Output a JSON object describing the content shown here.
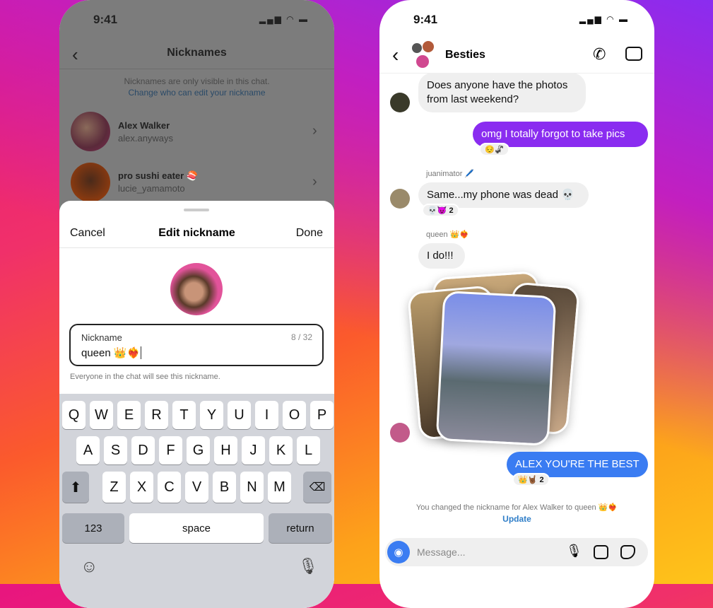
{
  "left": {
    "status_time": "9:41",
    "nav_title": "Nicknames",
    "info_text": "Nicknames are only visible in this chat.",
    "info_link": "Change who can edit your nickname",
    "members": [
      {
        "name": "Alex Walker",
        "username": "alex.anyways"
      },
      {
        "name": "pro sushi eater 🍣",
        "username": "lucie_yamamoto"
      }
    ],
    "sheet": {
      "cancel": "Cancel",
      "title": "Edit nickname",
      "done": "Done",
      "field_label": "Nickname",
      "field_value": "queen 👑❤️‍🔥",
      "counter": "8 / 32",
      "helper": "Everyone in the chat will see this nickname."
    },
    "keyboard": {
      "row1": [
        "Q",
        "W",
        "E",
        "R",
        "T",
        "Y",
        "U",
        "I",
        "O",
        "P"
      ],
      "row2": [
        "A",
        "S",
        "D",
        "F",
        "G",
        "H",
        "J",
        "K",
        "L"
      ],
      "row3": [
        "Z",
        "X",
        "C",
        "V",
        "B",
        "N",
        "M"
      ],
      "numbers": "123",
      "space": "space",
      "return": "return"
    }
  },
  "right": {
    "status_time": "9:41",
    "chat_title": "Besties",
    "messages": {
      "m1": "Does anyone have the photos from last weekend?",
      "m2": "omg I totally forgot to take pics",
      "m2_react": "😔🦨",
      "sender3": "juanimator 🖊️",
      "m3": "Same...my phone was dead 💀",
      "m3_react": "💀😈 2",
      "sender4": "queen 👑❤️‍🔥",
      "m4": "I do!!!",
      "m5": "ALEX YOU'RE THE BEST",
      "m5_react": "👑🤘🏾 2"
    },
    "system_msg": "You changed the nickname for Alex Walker to queen 👑❤️‍🔥",
    "system_link": "Update",
    "composer_placeholder": "Message...",
    "colors": {
      "outgoing_purple": "#8a2cf0",
      "outgoing_blue": "#3a7cf2",
      "link": "#2f7ec8"
    }
  }
}
